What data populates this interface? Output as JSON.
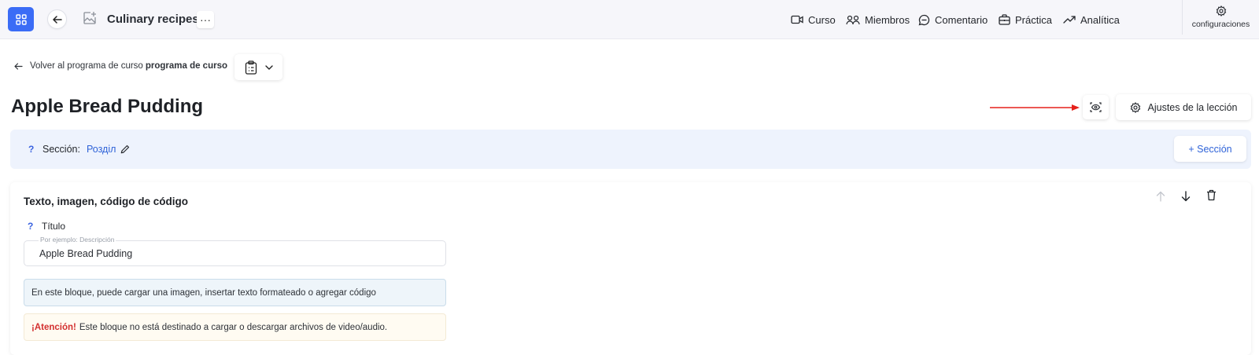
{
  "header": {
    "course_title": "Culinary recipes",
    "more_label": "···",
    "nav": [
      {
        "label": "Curso",
        "icon": "video-camera-icon"
      },
      {
        "label": "Miembros",
        "icon": "users-icon"
      },
      {
        "label": "Comentario",
        "icon": "comment-bubble-icon"
      },
      {
        "label": "Práctica",
        "icon": "briefcase-icon"
      },
      {
        "label": "Analítica",
        "icon": "trending-up-icon"
      }
    ],
    "settings_label": "configuraciones"
  },
  "breadcrumb": {
    "prefix": "Volver al programa de curso",
    "strong": "programa de curso"
  },
  "lesson": {
    "title": "Apple Bread Pudding",
    "settings_button": "Ajustes de la lección"
  },
  "section": {
    "help": "?",
    "label": "Sección:",
    "value": "Розділ",
    "add_button": "+ Sección"
  },
  "block": {
    "title": "Texto, imagen, código de código",
    "field_help": "?",
    "field_label": "Título",
    "field_placeholder": "Por ejemplo: Descripción",
    "field_value": "Apple Bread Pudding",
    "info_text": "En este bloque, puede cargar una imagen, insertar texto formateado o agregar código",
    "warning_strong": "¡Atención!",
    "warning_text": "Este bloque no está destinado a cargar o descargar archivos de video/audio."
  },
  "colors": {
    "accent": "#3b6cf6",
    "link": "#2f63d8",
    "annotation_arrow": "#e5211b",
    "warning": "#d32f2f"
  }
}
